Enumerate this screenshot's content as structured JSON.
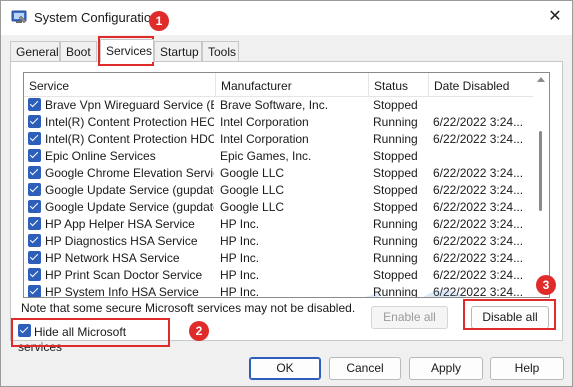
{
  "window": {
    "title": "System Configuration",
    "icon": "msconfig-icon",
    "close_glyph": "✕"
  },
  "tabs": [
    {
      "label": "General",
      "active": false
    },
    {
      "label": "Boot",
      "active": false
    },
    {
      "label": "Services",
      "active": true
    },
    {
      "label": "Startup",
      "active": false
    },
    {
      "label": "Tools",
      "active": false
    }
  ],
  "table": {
    "columns": [
      "Service",
      "Manufacturer",
      "Status",
      "Date Disabled"
    ],
    "rows": [
      {
        "service": "Brave Vpn Wireguard Service (B...",
        "manufacturer": "Brave Software, Inc.",
        "status": "Stopped",
        "date": ""
      },
      {
        "service": "Intel(R) Content Protection HEC...",
        "manufacturer": "Intel Corporation",
        "status": "Running",
        "date": "6/22/2022 3:24..."
      },
      {
        "service": "Intel(R) Content Protection HDC...",
        "manufacturer": "Intel Corporation",
        "status": "Running",
        "date": "6/22/2022 3:24..."
      },
      {
        "service": "Epic Online Services",
        "manufacturer": "Epic Games, Inc.",
        "status": "Stopped",
        "date": ""
      },
      {
        "service": "Google Chrome Elevation Servic...",
        "manufacturer": "Google LLC",
        "status": "Stopped",
        "date": "6/22/2022 3:24..."
      },
      {
        "service": "Google Update Service (gupdate)",
        "manufacturer": "Google LLC",
        "status": "Stopped",
        "date": "6/22/2022 3:24..."
      },
      {
        "service": "Google Update Service (gupdatem)",
        "manufacturer": "Google LLC",
        "status": "Stopped",
        "date": "6/22/2022 3:24..."
      },
      {
        "service": "HP App Helper HSA Service",
        "manufacturer": "HP Inc.",
        "status": "Running",
        "date": "6/22/2022 3:24..."
      },
      {
        "service": "HP Diagnostics HSA Service",
        "manufacturer": "HP Inc.",
        "status": "Running",
        "date": "6/22/2022 3:24..."
      },
      {
        "service": "HP Network HSA Service",
        "manufacturer": "HP Inc.",
        "status": "Running",
        "date": "6/22/2022 3:24..."
      },
      {
        "service": "HP Print Scan Doctor Service",
        "manufacturer": "HP Inc.",
        "status": "Stopped",
        "date": "6/22/2022 3:24..."
      },
      {
        "service": "HP System Info HSA Service",
        "manufacturer": "HP Inc.",
        "status": "Running",
        "date": "6/22/2022 3:24..."
      }
    ]
  },
  "note": "Note that some secure Microsoft services may not be disabled.",
  "hide_ms": {
    "label": "Hide all Microsoft services",
    "checked": true
  },
  "buttons": {
    "enable_all": "Enable all",
    "disable_all": "Disable all",
    "ok": "OK",
    "cancel": "Cancel",
    "apply": "Apply",
    "help": "Help"
  },
  "annotations": {
    "badge_1": "1",
    "badge_2": "2",
    "badge_3": "3"
  },
  "colors": {
    "accent": "#2d5fba",
    "highlight": "#e02b2b"
  }
}
